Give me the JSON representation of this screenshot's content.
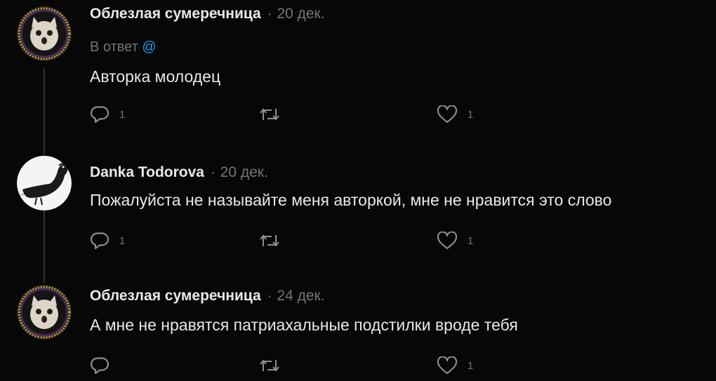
{
  "tweets": [
    {
      "author": "Облезлая сумеречница",
      "separator": "·",
      "date": "20 дек.",
      "reply_label": "В ответ",
      "reply_mention": "@",
      "text": "Авторка молодец",
      "replies": "1",
      "retweets": "",
      "likes": "1"
    },
    {
      "author": "Danka Todorova",
      "separator": "·",
      "date": "20 дек.",
      "text": "Пожалуйста не называйте меня авторкой, мне не нравится это слово",
      "replies": "1",
      "retweets": "",
      "likes": "1"
    },
    {
      "author": "Облезлая сумеречница",
      "separator": "·",
      "date": "24 дек.",
      "text": "А мне не нравятся патриахальные подстилки вроде тебя",
      "replies": "",
      "retweets": "",
      "likes": "1"
    }
  ],
  "icons": {
    "reply": "reply-icon",
    "retweet": "retweet-icon",
    "like": "like-icon",
    "avatar_cat": "cat-avatar",
    "avatar_pigeon": "pigeon-avatar"
  },
  "colors": {
    "background": "#070707",
    "text": "#e7e9ea",
    "muted": "#71767b",
    "mention": "#1d9bf0",
    "thread_line": "#2f3336"
  }
}
